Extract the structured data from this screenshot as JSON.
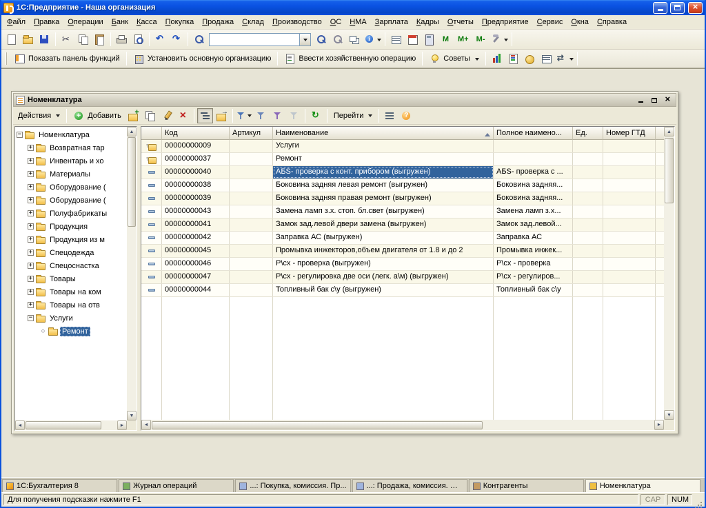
{
  "window": {
    "title": "1С:Предприятие - Наша организация"
  },
  "menu": {
    "items": [
      {
        "label": "Файл"
      },
      {
        "label": "Правка"
      },
      {
        "label": "Операции"
      },
      {
        "label": "Банк"
      },
      {
        "label": "Касса"
      },
      {
        "label": "Покупка"
      },
      {
        "label": "Продажа"
      },
      {
        "label": "Склад"
      },
      {
        "label": "Производство"
      },
      {
        "label": "ОС"
      },
      {
        "label": "НМА"
      },
      {
        "label": "Зарплата"
      },
      {
        "label": "Кадры"
      },
      {
        "label": "Отчеты"
      },
      {
        "label": "Предприятие"
      },
      {
        "label": "Сервис"
      },
      {
        "label": "Окна"
      },
      {
        "label": "Справка"
      }
    ]
  },
  "toolbar": {
    "memory": [
      "M",
      "M+",
      "M-"
    ]
  },
  "funcbar": {
    "show_functions": "Показать панель функций",
    "set_main_org": "Установить основную организацию",
    "enter_operation": "Ввести хозяйственную операцию",
    "tips": "Советы"
  },
  "panel": {
    "title": "Номенклатура",
    "actions_label": "Действия",
    "add_label": "Добавить",
    "goto_label": "Перейти"
  },
  "tree": {
    "items": [
      {
        "label": "Номенклатура",
        "pad": 2,
        "exp": "−"
      },
      {
        "label": "Возвратная тар",
        "pad": 18,
        "exp": "+"
      },
      {
        "label": "Инвентарь и хо",
        "pad": 18,
        "exp": "+"
      },
      {
        "label": "Материалы",
        "pad": 18,
        "exp": "+"
      },
      {
        "label": "Оборудование (",
        "pad": 18,
        "exp": "+"
      },
      {
        "label": "Оборудование (",
        "pad": 18,
        "exp": "+"
      },
      {
        "label": "Полуфабрикаты",
        "pad": 18,
        "exp": "+"
      },
      {
        "label": "Продукция",
        "pad": 18,
        "exp": "+"
      },
      {
        "label": "Продукция из м",
        "pad": 18,
        "exp": "+"
      },
      {
        "label": "Спецодежда",
        "pad": 18,
        "exp": "+"
      },
      {
        "label": "Спецоснастка",
        "pad": 18,
        "exp": "+"
      },
      {
        "label": "Товары",
        "pad": 18,
        "exp": "+"
      },
      {
        "label": "Товары на ком",
        "pad": 18,
        "exp": "+"
      },
      {
        "label": "Товары на отв",
        "pad": 18,
        "exp": "+"
      },
      {
        "label": "Услуги",
        "pad": 18,
        "exp": "−"
      },
      {
        "label": "Ремонт",
        "pad": 36,
        "exp": "○",
        "nobox": true,
        "selected": true
      }
    ]
  },
  "table": {
    "headers": {
      "code": "Код",
      "article": "Артикул",
      "name": "Наименование",
      "fullname": "Полное наимено...",
      "unit": "Ед.",
      "gtd": "Номер ГТД"
    },
    "rows": [
      {
        "code": "00000000009",
        "article": "",
        "name": "Услуги",
        "fullname": "",
        "unit": "",
        "gtd": "",
        "is_group": true
      },
      {
        "code": "00000000037",
        "article": "",
        "name": "Ремонт",
        "fullname": "",
        "unit": "",
        "gtd": "",
        "is_group": true
      },
      {
        "code": "00000000040",
        "article": "",
        "name": "АБS- проверка с конт. прибором (выгружен)",
        "fullname": "АБS- проверка с ...",
        "unit": "",
        "gtd": "",
        "is_item": true,
        "selected": true
      },
      {
        "code": "00000000038",
        "article": "",
        "name": "Боковина задняя левая ремонт (выгружен)",
        "fullname": "Боковина задняя...",
        "unit": "",
        "gtd": "",
        "is_item": true
      },
      {
        "code": "00000000039",
        "article": "",
        "name": "Боковина задняя правая ремонт (выгружен)",
        "fullname": "Боковина задняя...",
        "unit": "",
        "gtd": "",
        "is_item": true
      },
      {
        "code": "00000000043",
        "article": "",
        "name": "Замена ламп з.х. стоп. бл.свет (выгружен)",
        "fullname": "Замена ламп з.х...",
        "unit": "",
        "gtd": "",
        "is_item": true
      },
      {
        "code": "00000000041",
        "article": "",
        "name": "Замок зад.левой двери замена (выгружен)",
        "fullname": "Замок зад.левой...",
        "unit": "",
        "gtd": "",
        "is_item": true
      },
      {
        "code": "00000000042",
        "article": "",
        "name": "Заправка АС (выгружен)",
        "fullname": "Заправка АС",
        "unit": "",
        "gtd": "",
        "is_item": true
      },
      {
        "code": "00000000045",
        "article": "",
        "name": "Промывка инжекторов,объем двигателя от 1.8 и до 2",
        "fullname": "Промывка инжек...",
        "unit": "",
        "gtd": "",
        "is_item": true
      },
      {
        "code": "00000000046",
        "article": "",
        "name": "Р\\сх - проверка (выгружен)",
        "fullname": "Р\\сх - проверка",
        "unit": "",
        "gtd": "",
        "is_item": true
      },
      {
        "code": "00000000047",
        "article": "",
        "name": "Р\\сх - регулировка две оси (легк. а\\м) (выгружен)",
        "fullname": "Р\\сх - регулиров...",
        "unit": "",
        "gtd": "",
        "is_item": true
      },
      {
        "code": "00000000044",
        "article": "",
        "name": "Топливный бак с\\у (выгружен)",
        "fullname": "Топливный бак с\\у",
        "unit": "",
        "gtd": "",
        "is_item": true
      }
    ]
  },
  "taskbar": {
    "tabs": [
      {
        "label": "1С:Бухгалтерия 8"
      },
      {
        "label": "Журнал операций"
      },
      {
        "label": "...: Покупка, комиссия. Пр..."
      },
      {
        "label": "...: Продажа, комиссия. Не..."
      },
      {
        "label": "Контрагенты"
      },
      {
        "label": "Номенклатура",
        "active": true
      }
    ]
  },
  "statusbar": {
    "hint": "Для получения подсказки нажмите F1",
    "cap": "CAP",
    "num": "NUM"
  },
  "colors": {
    "selection": "#31639c",
    "titlebar": "#0a52e2",
    "window_bg": "#ece9d8"
  }
}
